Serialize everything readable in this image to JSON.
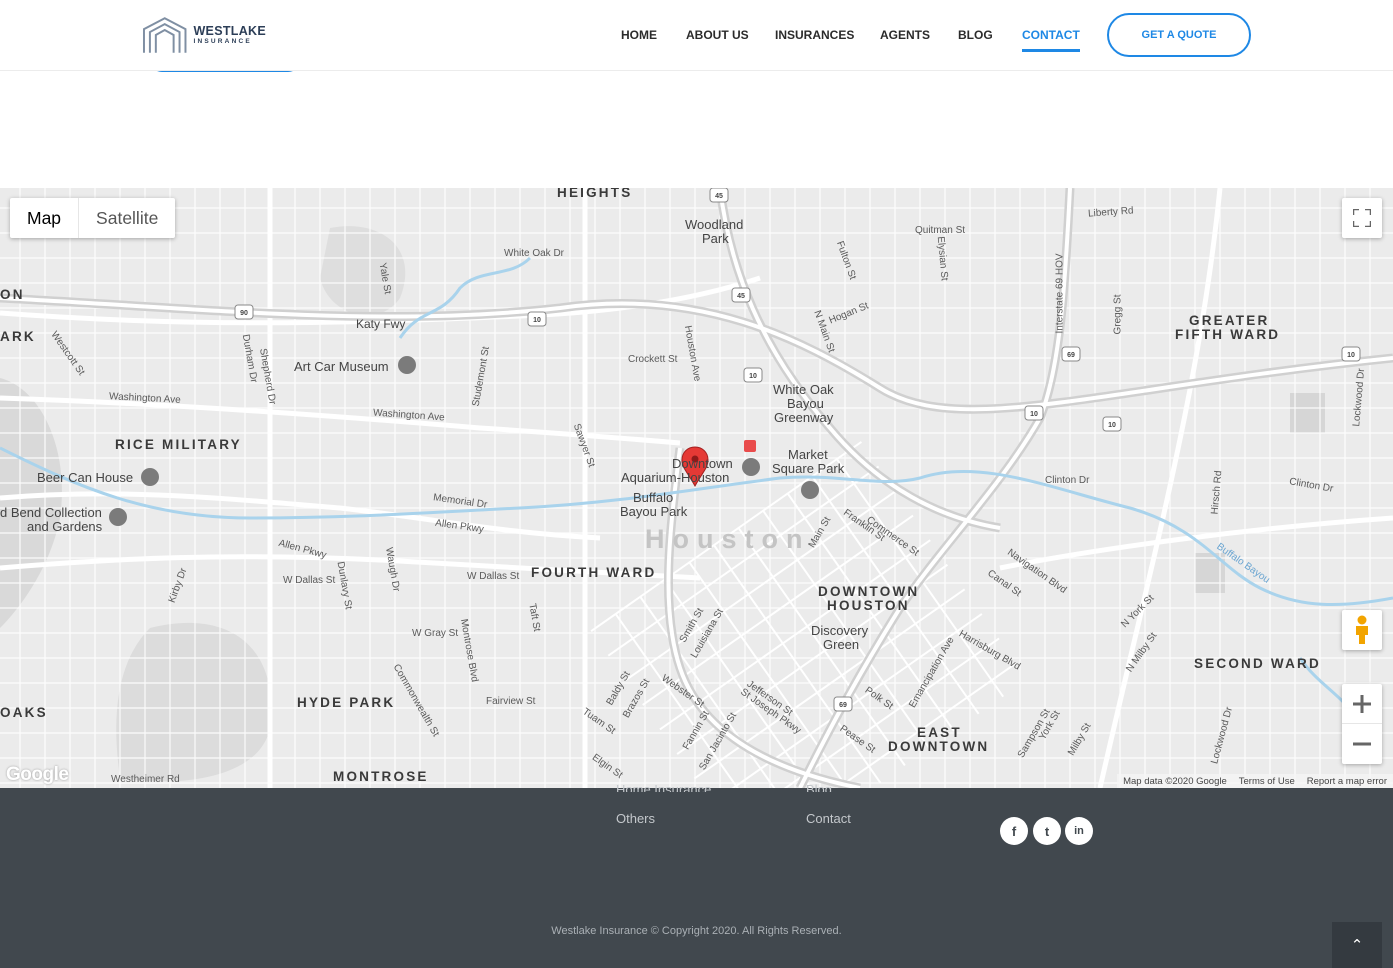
{
  "header": {
    "logo": {
      "line1": "WESTLAKE",
      "line2": "INSURANCE"
    },
    "nav": [
      {
        "label": "HOME",
        "active": false
      },
      {
        "label": "ABOUT US",
        "active": false
      },
      {
        "label": "INSURANCES",
        "active": false
      },
      {
        "label": "AGENTS",
        "active": false
      },
      {
        "label": "BLOG",
        "active": false
      },
      {
        "label": "CONTACT",
        "active": true
      }
    ],
    "cta_label": "GET A QUOTE"
  },
  "map": {
    "type_buttons": [
      "Map",
      "Satellite"
    ],
    "selected_type": "Map",
    "city_label": "Houston",
    "districts": [
      "HEIGHTS",
      "GREATER",
      "FIFTH WARD",
      "RICE MILITARY",
      "FOURTH WARD",
      "DOWNTOWN",
      "HOUSTON",
      "SECOND WARD",
      "HYDE PARK",
      "MONTROSE",
      "EAST",
      "DOWNTOWN",
      "ON",
      "ARK",
      "OAKS"
    ],
    "pois": [
      "Woodland",
      "Park",
      "Art Car Museum",
      "White Oak",
      "Bayou",
      "Greenway",
      "Market",
      "Square Park",
      "Downtown",
      "Aquarium-Houston",
      "Buffalo",
      "Bayou Park",
      "Beer Can House",
      "d Bend Collection",
      "and Gardens",
      "Discovery",
      "Green"
    ],
    "streets": [
      "White Oak Dr",
      "Quitman St",
      "Liberty Rd",
      "Katy Fwy",
      "Hogan St",
      "Crockett St",
      "Washington Ave",
      "Washington Ave",
      "Memorial Dr",
      "Allen Pkwy",
      "Allen Pkwy",
      "W Dallas St",
      "W Dallas St",
      "W Gray St",
      "Fairview St",
      "Westheimer Rd",
      "Clinton Dr",
      "Clinton Dr",
      "Navigation Blvd",
      "Canal St",
      "Harrisburg Blvd",
      "Buffalo Bayou",
      "Interstate 69 HOV",
      "Gregg St",
      "Hirsch Rd",
      "Lockwood Dr",
      "Yale St",
      "Durham Dr",
      "Shepherd Dr",
      "Studemont St",
      "Houston Ave",
      "Sawyer St",
      "N Main St",
      "Fulton St",
      "Elysian St",
      "Main St",
      "Franklin St",
      "Commerce St",
      "Smith St",
      "Louisiana St",
      "Jefferson St",
      "St Joseph Pkwy",
      "Polk St",
      "Pease St",
      "Emancipation Ave",
      "Webster St",
      "Fannin St",
      "San Jacinto St",
      "N York St",
      "N Milby St",
      "Westcott St",
      "Kirby Dr",
      "Dunlavy St",
      "Waugh Dr",
      "Montrose Blvd",
      "Taft St",
      "Commonwealth St",
      "Baldy St",
      "Brazos St",
      "Tuam St",
      "Elgin St",
      "Sampson St",
      "York St",
      "Milby St",
      "Lockwood Dr"
    ],
    "highway_shields": [
      "90",
      "10",
      "45",
      "69"
    ],
    "google_logo": "Google",
    "attribution": [
      "Map data ©2020 Google",
      "Terms of Use",
      "Report a map error"
    ]
  },
  "footer": {
    "col1": [
      "Home Insurance",
      "Others"
    ],
    "col2": [
      "Blog",
      "Contact"
    ],
    "social": [
      {
        "icon": "facebook-icon",
        "glyph": "f"
      },
      {
        "icon": "twitter-icon",
        "glyph": "t"
      },
      {
        "icon": "linkedin-icon",
        "glyph": "in"
      }
    ],
    "copyright": "Westlake Insurance © Copyright 2020. All Rights Reserved.",
    "back_to_top_glyph": "⌃"
  }
}
